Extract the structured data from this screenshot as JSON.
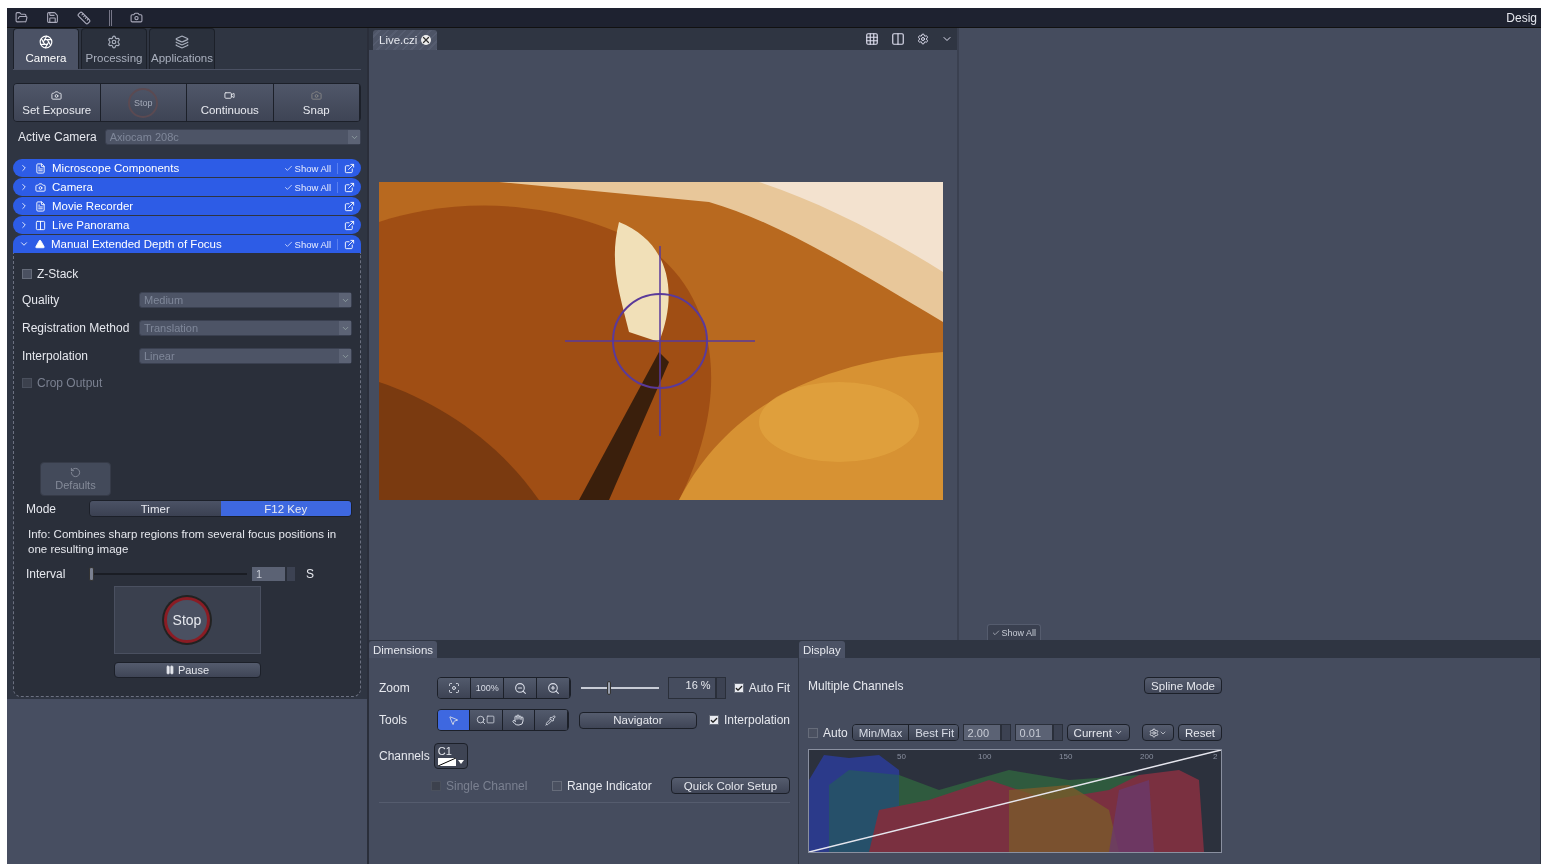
{
  "toolbar": {
    "title": "Desig"
  },
  "left_tabs": [
    {
      "label": "Camera",
      "selected": true,
      "kind": "camera"
    },
    {
      "label": "Processing",
      "selected": false,
      "kind": "processing"
    },
    {
      "label": "Applications",
      "selected": false,
      "kind": "applications"
    }
  ],
  "acquisition_buttons": [
    {
      "label": "Set Exposure",
      "kind": "exposure"
    },
    {
      "label": "Stop",
      "kind": "stop"
    },
    {
      "label": "Continuous",
      "kind": "continuous"
    },
    {
      "label": "Snap",
      "kind": "snap"
    }
  ],
  "active_camera": {
    "label": "Active Camera",
    "value": "Axiocam 208c"
  },
  "tool_groups": [
    {
      "title": "Microscope Components",
      "expanded": false,
      "show_all": "Show All",
      "kind": "doc"
    },
    {
      "title": "Camera",
      "expanded": false,
      "show_all": "Show All",
      "kind": "camera"
    },
    {
      "title": "Movie Recorder",
      "expanded": false,
      "kind": "doc"
    },
    {
      "title": "Live Panorama",
      "expanded": false,
      "kind": "panorama"
    },
    {
      "title": "Manual Extended Depth of Focus",
      "expanded": true,
      "show_all": "Show All",
      "kind": "focus"
    }
  ],
  "edf": {
    "zstack": {
      "label": "Z-Stack",
      "checked": false,
      "disabled": false
    },
    "fields": [
      {
        "label": "Quality",
        "value": "Medium"
      },
      {
        "label": "Registration Method",
        "value": "Translation"
      },
      {
        "label": "Interpolation",
        "value": "Linear"
      }
    ],
    "crop_output": {
      "label": "Crop Output",
      "checked": false,
      "disabled": true
    },
    "defaults": "Defaults",
    "mode": {
      "label": "Mode",
      "options": [
        {
          "label": "Timer",
          "selected": false
        },
        {
          "label": "F12 Key",
          "selected": true
        }
      ]
    },
    "info": "Info: Combines sharp regions from several focus positions in one resulting image",
    "interval": {
      "label": "Interval",
      "level": 0,
      "value": "1",
      "unit": "S"
    },
    "stop": "Stop",
    "pause": "Pause"
  },
  "viewer": {
    "tab": "Live.czi",
    "show_all": "Show All"
  },
  "dimensions": {
    "title": "Dimensions",
    "zoom": {
      "label": "Zoom",
      "buttons": [
        {
          "kind": "fit"
        },
        {
          "kind": "percent",
          "label": "100%"
        },
        {
          "kind": "zoom-out"
        },
        {
          "kind": "zoom-in"
        }
      ],
      "level": 0.34,
      "value": "16 %",
      "auto_fit": {
        "label": "Auto Fit",
        "checked": true,
        "disabled": false
      }
    },
    "tools": {
      "label": "Tools",
      "items": [
        {
          "kind": "pointer",
          "selected": true
        },
        {
          "kind": "zoom-rect",
          "selected": false
        },
        {
          "kind": "pan",
          "selected": false
        },
        {
          "kind": "pipette",
          "selected": false
        }
      ],
      "navigator": "Navigator",
      "interpolation": {
        "label": "Interpolation",
        "checked": true,
        "disabled": false
      }
    },
    "channels": {
      "label": "Channels",
      "channel": "C1"
    },
    "single_channel": {
      "label": "Single Channel",
      "checked": false,
      "disabled": true
    },
    "range_indicator": {
      "label": "Range Indicator",
      "checked": false,
      "disabled": false
    },
    "quick_color": "Quick Color Setup"
  },
  "display": {
    "title": "Display",
    "mode": "Multiple Channels",
    "spline": "Spline Mode",
    "auto": {
      "label": "Auto",
      "checked": false,
      "disabled": false
    },
    "buttons": [
      "Min/Max",
      "Best Fit"
    ],
    "gamma": "2.00",
    "step": "0.01",
    "current": "Current",
    "reset": "Reset",
    "ticks": [
      "50",
      "100",
      "150",
      "200",
      "2"
    ]
  }
}
